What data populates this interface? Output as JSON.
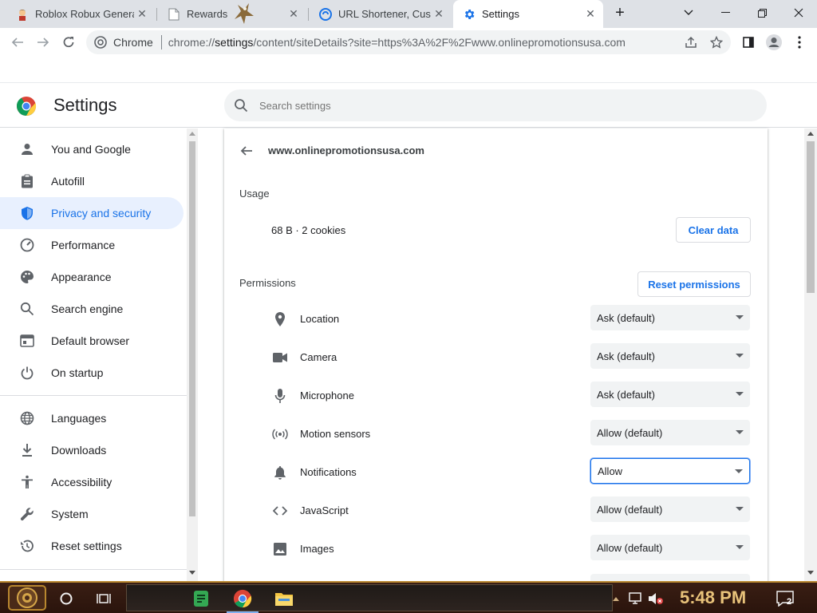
{
  "tabs": [
    {
      "title": "Roblox Robux Genera",
      "icon": "roblox-avatar-icon"
    },
    {
      "title": "Rewards",
      "icon": "page-icon"
    },
    {
      "title": "URL Shortener, Custo",
      "icon": "link-shortener-icon"
    },
    {
      "title": "Settings",
      "icon": "settings-gear-icon",
      "active": true
    }
  ],
  "toolbar": {
    "chip_label": "Chrome",
    "url_scheme": "chrome://",
    "url_host": "settings",
    "url_rest": "/content/siteDetails?site=https%3A%2F%2Fwww.onlinepromotionsusa.com"
  },
  "header": {
    "title": "Settings",
    "search_placeholder": "Search settings"
  },
  "sidebar": {
    "items": [
      {
        "label": "You and Google",
        "icon": "person-icon"
      },
      {
        "label": "Autofill",
        "icon": "clipboard-icon"
      },
      {
        "label": "Privacy and security",
        "icon": "shield-icon",
        "active": true
      },
      {
        "label": "Performance",
        "icon": "speedometer-icon"
      },
      {
        "label": "Appearance",
        "icon": "palette-icon"
      },
      {
        "label": "Search engine",
        "icon": "search-icon"
      },
      {
        "label": "Default browser",
        "icon": "browser-icon"
      },
      {
        "label": "On startup",
        "icon": "power-icon"
      },
      {
        "label": "Languages",
        "icon": "globe-icon"
      },
      {
        "label": "Downloads",
        "icon": "download-icon"
      },
      {
        "label": "Accessibility",
        "icon": "accessibility-icon"
      },
      {
        "label": "System",
        "icon": "wrench-icon"
      },
      {
        "label": "Reset settings",
        "icon": "history-icon"
      }
    ]
  },
  "site": {
    "host": "www.onlinepromotionsusa.com",
    "usage_label": "Usage",
    "usage_value": "68 B · 2 cookies",
    "clear_label": "Clear data",
    "permissions_label": "Permissions",
    "reset_label": "Reset permissions",
    "permissions": [
      {
        "label": "Location",
        "value": "Ask (default)",
        "icon": "location-pin-icon"
      },
      {
        "label": "Camera",
        "value": "Ask (default)",
        "icon": "camera-icon"
      },
      {
        "label": "Microphone",
        "value": "Ask (default)",
        "icon": "microphone-icon"
      },
      {
        "label": "Motion sensors",
        "value": "Allow (default)",
        "icon": "motion-sensors-icon"
      },
      {
        "label": "Notifications",
        "value": "Allow",
        "icon": "bell-icon",
        "focused": true
      },
      {
        "label": "JavaScript",
        "value": "Allow (default)",
        "icon": "code-icon"
      },
      {
        "label": "Images",
        "value": "Allow (default)",
        "icon": "image-icon"
      }
    ]
  },
  "taskbar": {
    "clock": "5:48 PM",
    "notification_count": "2"
  },
  "colors": {
    "accent": "#1a73e8",
    "active_nav_bg": "#e8f0fe",
    "tabstrip_bg": "#dee1e6"
  }
}
